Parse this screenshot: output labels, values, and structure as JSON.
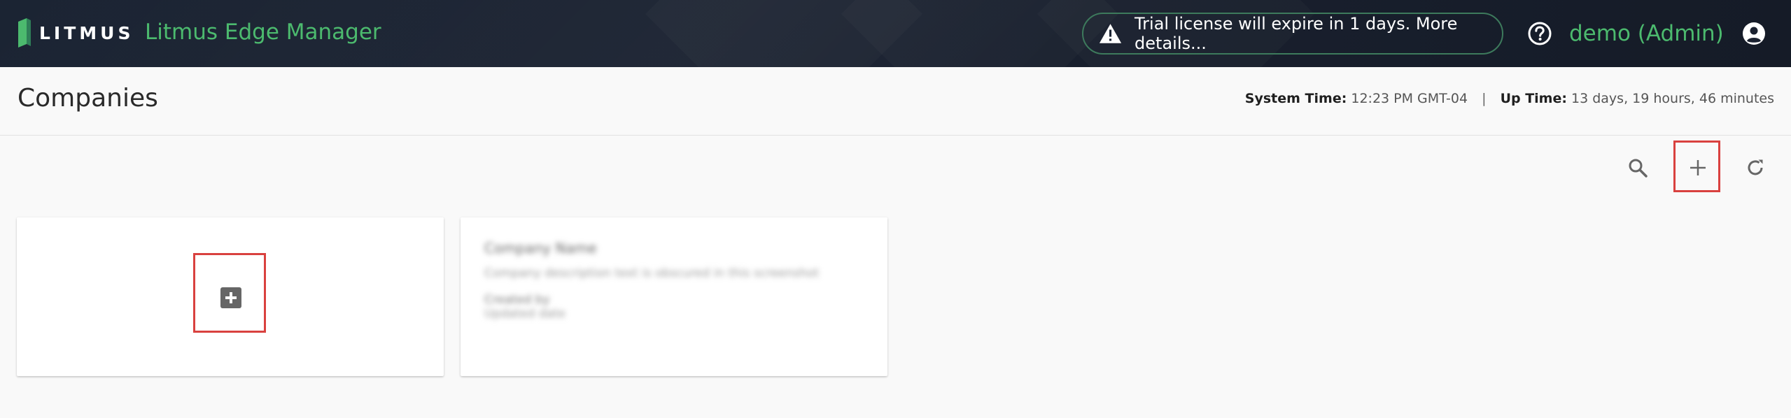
{
  "header": {
    "brand_word": "LITMUS",
    "app_title": "Litmus Edge Manager",
    "trial_notice": "Trial license will expire in 1 days. More details...",
    "user_label": "demo (Admin)",
    "icons": {
      "brand": "litmus-logo-icon",
      "warning": "warning-icon",
      "help": "help-icon",
      "account": "account-icon"
    }
  },
  "page": {
    "title": "Companies",
    "system_time_label": "System Time:",
    "system_time_value": "12:23 PM GMT-04",
    "separator": "|",
    "up_time_label": "Up Time:",
    "up_time_value": "13 days, 19 hours, 46 minutes"
  },
  "toolbar": {
    "icons": [
      "search-icon",
      "add-icon",
      "refresh-icon"
    ]
  },
  "cards": [
    {
      "type": "add",
      "icon": "add-box-icon"
    },
    {
      "type": "company",
      "name": "Company Name",
      "description": "Company description text is obscured in this screenshot",
      "meta1": "Created by",
      "meta2": "Updated date"
    }
  ],
  "colors": {
    "accent_green": "#4cba6e",
    "header_bg": "#1b2433",
    "highlight_red": "#d9413f",
    "page_bg": "#f9f9f9",
    "card_bg": "#ffffff"
  }
}
